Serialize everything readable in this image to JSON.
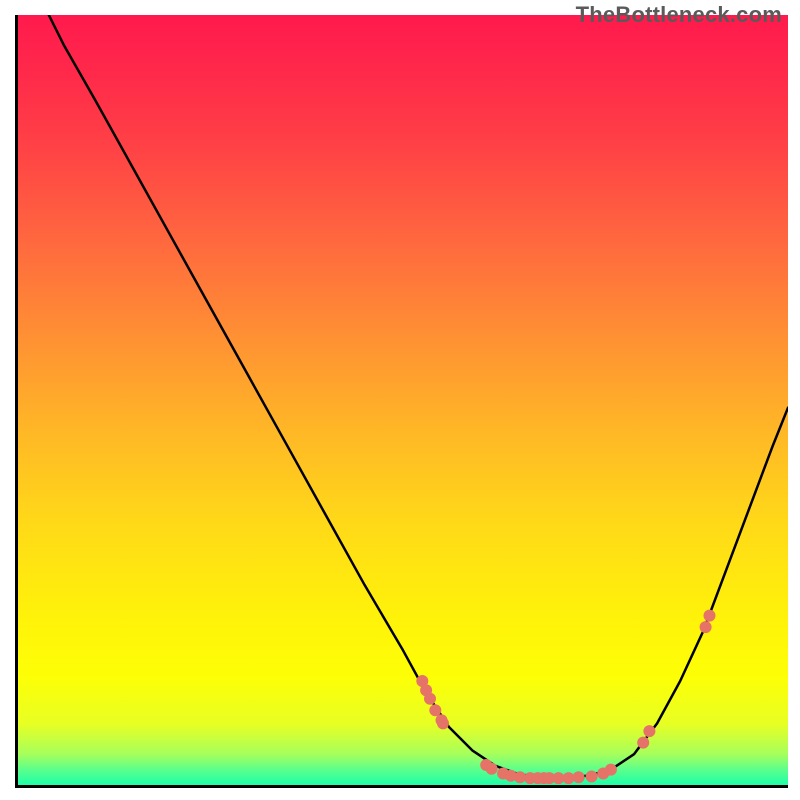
{
  "watermark": "TheBottleneck.com",
  "colors": {
    "curve": "#000000",
    "marker": "#e57368",
    "axis": "#000000",
    "gradient_top": "#ff1a4d",
    "gradient_bottom": "#1effa8"
  },
  "chart_data": {
    "type": "line",
    "title": "",
    "xlabel": "",
    "ylabel": "",
    "xlim": [
      0,
      100
    ],
    "ylim": [
      0,
      100
    ],
    "grid": false,
    "legend": false,
    "curve": [
      {
        "x": 4,
        "y": 100
      },
      {
        "x": 6,
        "y": 96
      },
      {
        "x": 10,
        "y": 89
      },
      {
        "x": 15,
        "y": 80
      },
      {
        "x": 20,
        "y": 71
      },
      {
        "x": 25,
        "y": 62
      },
      {
        "x": 30,
        "y": 53
      },
      {
        "x": 35,
        "y": 44
      },
      {
        "x": 40,
        "y": 35
      },
      {
        "x": 45,
        "y": 26
      },
      {
        "x": 50,
        "y": 17.5
      },
      {
        "x": 53,
        "y": 12
      },
      {
        "x": 56,
        "y": 7.5
      },
      {
        "x": 59,
        "y": 4.5
      },
      {
        "x": 62,
        "y": 2.5
      },
      {
        "x": 65,
        "y": 1.4
      },
      {
        "x": 68,
        "y": 1.0
      },
      {
        "x": 71,
        "y": 1.0
      },
      {
        "x": 74,
        "y": 1.2
      },
      {
        "x": 77,
        "y": 2.0
      },
      {
        "x": 80,
        "y": 4.0
      },
      {
        "x": 83,
        "y": 8.0
      },
      {
        "x": 86,
        "y": 13.5
      },
      {
        "x": 89,
        "y": 20
      },
      {
        "x": 92,
        "y": 28
      },
      {
        "x": 95,
        "y": 36
      },
      {
        "x": 98,
        "y": 44
      },
      {
        "x": 100,
        "y": 49
      }
    ],
    "markers": [
      {
        "x": 52.5,
        "y": 13.5
      },
      {
        "x": 53.0,
        "y": 12.3
      },
      {
        "x": 53.5,
        "y": 11.2
      },
      {
        "x": 54.2,
        "y": 9.7
      },
      {
        "x": 55.0,
        "y": 8.4
      },
      {
        "x": 55.2,
        "y": 8.0
      },
      {
        "x": 60.8,
        "y": 2.6
      },
      {
        "x": 61.5,
        "y": 2.1
      },
      {
        "x": 63.0,
        "y": 1.5
      },
      {
        "x": 64.0,
        "y": 1.2
      },
      {
        "x": 65.2,
        "y": 1.0
      },
      {
        "x": 66.5,
        "y": 0.9
      },
      {
        "x": 67.5,
        "y": 0.9
      },
      {
        "x": 68.3,
        "y": 0.9
      },
      {
        "x": 69.0,
        "y": 0.9
      },
      {
        "x": 70.2,
        "y": 0.9
      },
      {
        "x": 71.5,
        "y": 0.9
      },
      {
        "x": 72.8,
        "y": 1.0
      },
      {
        "x": 74.5,
        "y": 1.1
      },
      {
        "x": 76.0,
        "y": 1.5
      },
      {
        "x": 77.0,
        "y": 2.0
      },
      {
        "x": 81.2,
        "y": 5.5
      },
      {
        "x": 82.0,
        "y": 7.0
      },
      {
        "x": 89.3,
        "y": 20.5
      },
      {
        "x": 89.8,
        "y": 22.0
      }
    ]
  }
}
